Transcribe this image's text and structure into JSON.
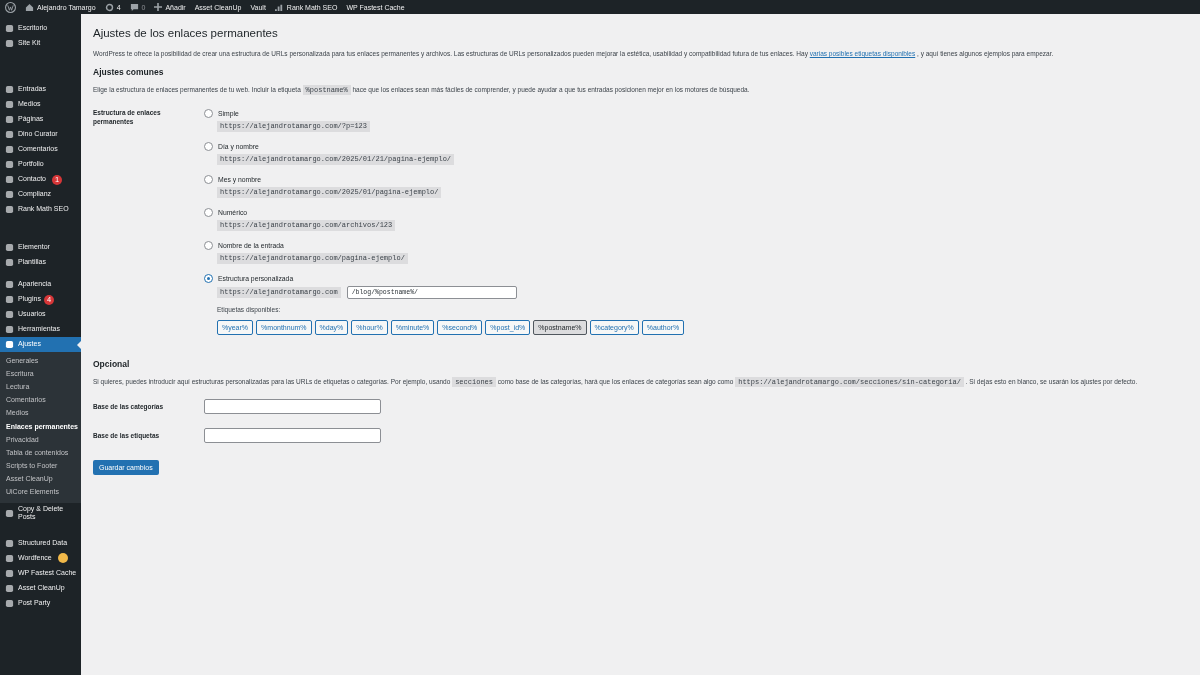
{
  "admin_bar": {
    "site": "Alejandro Tamargo",
    "updates": "4",
    "comments": "0",
    "new": "Añadir",
    "links": [
      "Asset CleanUp",
      "Vault"
    ],
    "rank_math": "Rank Math SEO",
    "cache": "WP Fastest Cache"
  },
  "sidebar": {
    "groups": [
      [
        {
          "label": "Escritorio",
          "selected": false
        },
        {
          "label": "Site Kit",
          "selected": false
        }
      ],
      [
        {
          "label": "Entradas",
          "selected": false
        },
        {
          "label": "Medios",
          "selected": false
        },
        {
          "label": "Páginas",
          "selected": false
        },
        {
          "label": "Dino Curator",
          "selected": false
        },
        {
          "label": "Comentarios",
          "selected": false
        },
        {
          "label": "Portfolio",
          "selected": false
        },
        {
          "label": "Contacto",
          "selected": false,
          "badge": {
            "text": "1",
            "color": "#d63638"
          }
        },
        {
          "label": "Complianz",
          "selected": false
        },
        {
          "label": "Rank Math SEO",
          "selected": false
        }
      ],
      [
        {
          "label": "Elementor",
          "selected": false
        },
        {
          "label": "Plantillas",
          "selected": false
        }
      ],
      [
        {
          "label": "Apariencia",
          "selected": false
        },
        {
          "label": "Plugins",
          "selected": false,
          "badge": {
            "text": "4",
            "color": "#d63638"
          }
        },
        {
          "label": "Usuarios",
          "selected": false
        },
        {
          "label": "Herramientas",
          "selected": false
        },
        {
          "label": "Ajustes",
          "selected": true,
          "children": [
            {
              "label": "Generales",
              "selected": false
            },
            {
              "label": "Escritura",
              "selected": false
            },
            {
              "label": "Lectura",
              "selected": false
            },
            {
              "label": "Comentarios",
              "selected": false
            },
            {
              "label": "Medios",
              "selected": false
            },
            {
              "label": "Enlaces permanentes",
              "selected": true
            },
            {
              "label": "Privacidad",
              "selected": false
            },
            {
              "label": "Tabla de contenidos",
              "selected": false
            },
            {
              "label": "Scripts to Footer",
              "selected": false
            },
            {
              "label": "Asset CleanUp",
              "selected": false
            },
            {
              "label": "UiCore Elements",
              "selected": false
            }
          ]
        },
        {
          "label": "Copy & Delete Posts",
          "selected": false
        }
      ],
      [
        {
          "label": "Structured Data",
          "selected": false
        },
        {
          "label": "Wordfence",
          "selected": false,
          "badge": {
            "color": "#f0b849"
          }
        },
        {
          "label": "WP Fastest Cache",
          "selected": false
        },
        {
          "label": "Asset CleanUp",
          "selected": false
        },
        {
          "label": "Post Party",
          "selected": false
        }
      ]
    ]
  },
  "title": "Ajustes de los enlaces permanentes",
  "intro": [
    {
      "kind": "text",
      "text": "WordPress te ofrece la posibilidad de crear una estructura de URLs personalizada para tus enlaces permanentes y archivos. Las estructuras de URLs personalizados pueden mejorar la estética, usabilidad y compatibilidad futura de tus enlaces. Hay"
    },
    {
      "kind": "link",
      "text": "varias posibles etiquetas disponibles"
    },
    {
      "kind": "text",
      "text": ", y aquí tienes algunos ejemplos para empezar."
    }
  ],
  "common": {
    "heading": "Ajustes comunes",
    "description": [
      {
        "kind": "text",
        "text": "Elige la estructura de enlaces permanentes de tu web. Incluir la etiqueta"
      },
      {
        "kind": "code",
        "text": "%postname%"
      },
      {
        "kind": "text",
        "text": "hace que los enlaces sean más fáciles de comprender, y puede ayudar a que tus entradas posicionen mejor en los motores de búsqueda."
      }
    ],
    "label": "Estructura de enlaces permanentes",
    "options": [
      {
        "label": "Simple",
        "example": "https://alejandrotamargo.com/?p=123",
        "selected": false
      },
      {
        "label": "Día y nombre",
        "example": "https://alejandrotamargo.com/2025/01/21/pagina-ejemplo/",
        "selected": false
      },
      {
        "label": "Mes y nombre",
        "example": "https://alejandrotamargo.com/2025/01/pagina-ejemplo/",
        "selected": false
      },
      {
        "label": "Numérico",
        "example": "https://alejandrotamargo.com/archivos/123",
        "selected": false
      },
      {
        "label": "Nombre de la entrada",
        "example": "https://alejandrotamargo.com/pagina-ejemplo/",
        "selected": false
      },
      {
        "label": "Estructura personalizada",
        "example": "https://alejandrotamargo.com",
        "value": "/blog/%postname%/",
        "selected": true
      }
    ],
    "tags_label": "Etiquetas disponibles:",
    "tags": [
      {
        "label": "%year%",
        "selected": false
      },
      {
        "label": "%monthnum%",
        "selected": false
      },
      {
        "label": "%day%",
        "selected": false
      },
      {
        "label": "%hour%",
        "selected": false
      },
      {
        "label": "%minute%",
        "selected": false
      },
      {
        "label": "%second%",
        "selected": false
      },
      {
        "label": "%post_id%",
        "selected": false
      },
      {
        "label": "%postname%",
        "selected": true
      },
      {
        "label": "%category%",
        "selected": false
      },
      {
        "label": "%author%",
        "selected": false
      }
    ]
  },
  "optional": {
    "heading": "Opcional",
    "description": [
      {
        "kind": "text",
        "text": "Si quieres, puedes introducir aquí estructuras personalizadas para las URLs de etiquetas o categorías. Por ejemplo, usando"
      },
      {
        "kind": "code",
        "text": "secciones"
      },
      {
        "kind": "text",
        "text": "como base de las categorías, hará que los enlaces de categorías sean algo como"
      },
      {
        "kind": "code",
        "text": "https://alejandrotamargo.com/secciones/sin-categoria/"
      },
      {
        "kind": "text",
        "text": ". Si dejas esto en blanco, se usarán los ajustes por defecto."
      }
    ],
    "fields": [
      {
        "label": "Base de las categorías"
      },
      {
        "label": "Base de las etiquetas"
      }
    ]
  },
  "save_button": "Guardar cambios"
}
